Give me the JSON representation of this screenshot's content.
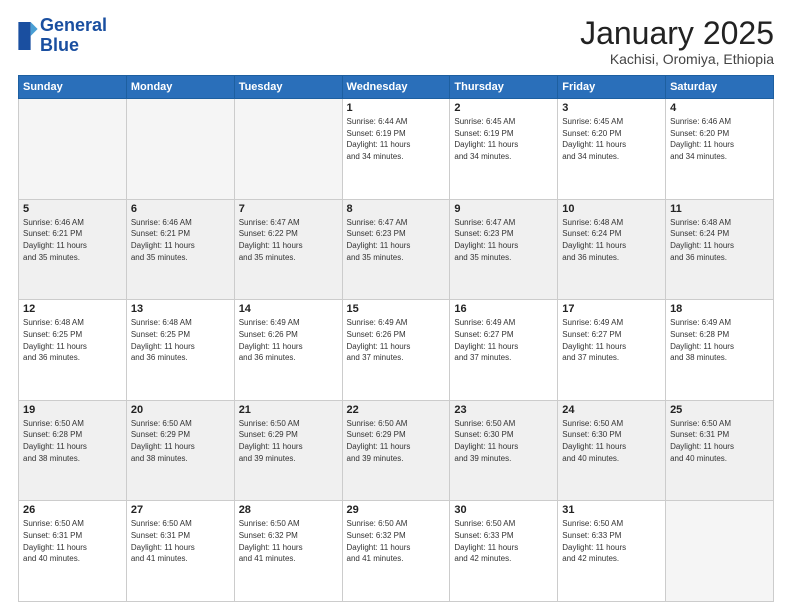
{
  "logo": {
    "line1": "General",
    "line2": "Blue"
  },
  "header": {
    "month": "January 2025",
    "location": "Kachisi, Oromiya, Ethiopia"
  },
  "weekdays": [
    "Sunday",
    "Monday",
    "Tuesday",
    "Wednesday",
    "Thursday",
    "Friday",
    "Saturday"
  ],
  "weeks": [
    [
      {
        "day": "",
        "info": ""
      },
      {
        "day": "",
        "info": ""
      },
      {
        "day": "",
        "info": ""
      },
      {
        "day": "1",
        "info": "Sunrise: 6:44 AM\nSunset: 6:19 PM\nDaylight: 11 hours\nand 34 minutes."
      },
      {
        "day": "2",
        "info": "Sunrise: 6:45 AM\nSunset: 6:19 PM\nDaylight: 11 hours\nand 34 minutes."
      },
      {
        "day": "3",
        "info": "Sunrise: 6:45 AM\nSunset: 6:20 PM\nDaylight: 11 hours\nand 34 minutes."
      },
      {
        "day": "4",
        "info": "Sunrise: 6:46 AM\nSunset: 6:20 PM\nDaylight: 11 hours\nand 34 minutes."
      }
    ],
    [
      {
        "day": "5",
        "info": "Sunrise: 6:46 AM\nSunset: 6:21 PM\nDaylight: 11 hours\nand 35 minutes."
      },
      {
        "day": "6",
        "info": "Sunrise: 6:46 AM\nSunset: 6:21 PM\nDaylight: 11 hours\nand 35 minutes."
      },
      {
        "day": "7",
        "info": "Sunrise: 6:47 AM\nSunset: 6:22 PM\nDaylight: 11 hours\nand 35 minutes."
      },
      {
        "day": "8",
        "info": "Sunrise: 6:47 AM\nSunset: 6:23 PM\nDaylight: 11 hours\nand 35 minutes."
      },
      {
        "day": "9",
        "info": "Sunrise: 6:47 AM\nSunset: 6:23 PM\nDaylight: 11 hours\nand 35 minutes."
      },
      {
        "day": "10",
        "info": "Sunrise: 6:48 AM\nSunset: 6:24 PM\nDaylight: 11 hours\nand 36 minutes."
      },
      {
        "day": "11",
        "info": "Sunrise: 6:48 AM\nSunset: 6:24 PM\nDaylight: 11 hours\nand 36 minutes."
      }
    ],
    [
      {
        "day": "12",
        "info": "Sunrise: 6:48 AM\nSunset: 6:25 PM\nDaylight: 11 hours\nand 36 minutes."
      },
      {
        "day": "13",
        "info": "Sunrise: 6:48 AM\nSunset: 6:25 PM\nDaylight: 11 hours\nand 36 minutes."
      },
      {
        "day": "14",
        "info": "Sunrise: 6:49 AM\nSunset: 6:26 PM\nDaylight: 11 hours\nand 36 minutes."
      },
      {
        "day": "15",
        "info": "Sunrise: 6:49 AM\nSunset: 6:26 PM\nDaylight: 11 hours\nand 37 minutes."
      },
      {
        "day": "16",
        "info": "Sunrise: 6:49 AM\nSunset: 6:27 PM\nDaylight: 11 hours\nand 37 minutes."
      },
      {
        "day": "17",
        "info": "Sunrise: 6:49 AM\nSunset: 6:27 PM\nDaylight: 11 hours\nand 37 minutes."
      },
      {
        "day": "18",
        "info": "Sunrise: 6:49 AM\nSunset: 6:28 PM\nDaylight: 11 hours\nand 38 minutes."
      }
    ],
    [
      {
        "day": "19",
        "info": "Sunrise: 6:50 AM\nSunset: 6:28 PM\nDaylight: 11 hours\nand 38 minutes."
      },
      {
        "day": "20",
        "info": "Sunrise: 6:50 AM\nSunset: 6:29 PM\nDaylight: 11 hours\nand 38 minutes."
      },
      {
        "day": "21",
        "info": "Sunrise: 6:50 AM\nSunset: 6:29 PM\nDaylight: 11 hours\nand 39 minutes."
      },
      {
        "day": "22",
        "info": "Sunrise: 6:50 AM\nSunset: 6:29 PM\nDaylight: 11 hours\nand 39 minutes."
      },
      {
        "day": "23",
        "info": "Sunrise: 6:50 AM\nSunset: 6:30 PM\nDaylight: 11 hours\nand 39 minutes."
      },
      {
        "day": "24",
        "info": "Sunrise: 6:50 AM\nSunset: 6:30 PM\nDaylight: 11 hours\nand 40 minutes."
      },
      {
        "day": "25",
        "info": "Sunrise: 6:50 AM\nSunset: 6:31 PM\nDaylight: 11 hours\nand 40 minutes."
      }
    ],
    [
      {
        "day": "26",
        "info": "Sunrise: 6:50 AM\nSunset: 6:31 PM\nDaylight: 11 hours\nand 40 minutes."
      },
      {
        "day": "27",
        "info": "Sunrise: 6:50 AM\nSunset: 6:31 PM\nDaylight: 11 hours\nand 41 minutes."
      },
      {
        "day": "28",
        "info": "Sunrise: 6:50 AM\nSunset: 6:32 PM\nDaylight: 11 hours\nand 41 minutes."
      },
      {
        "day": "29",
        "info": "Sunrise: 6:50 AM\nSunset: 6:32 PM\nDaylight: 11 hours\nand 41 minutes."
      },
      {
        "day": "30",
        "info": "Sunrise: 6:50 AM\nSunset: 6:33 PM\nDaylight: 11 hours\nand 42 minutes."
      },
      {
        "day": "31",
        "info": "Sunrise: 6:50 AM\nSunset: 6:33 PM\nDaylight: 11 hours\nand 42 minutes."
      },
      {
        "day": "",
        "info": ""
      }
    ]
  ]
}
